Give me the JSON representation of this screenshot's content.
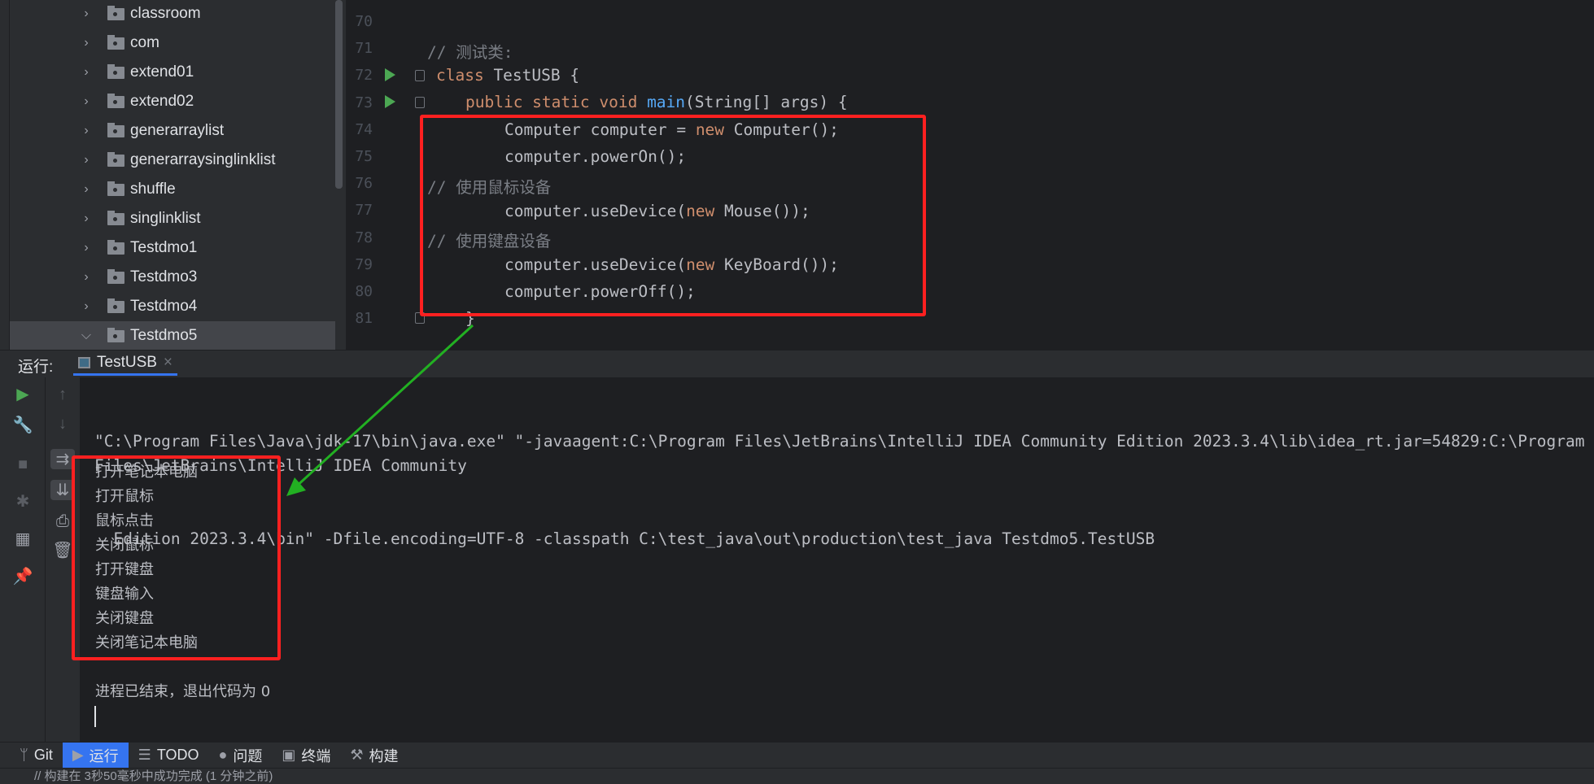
{
  "project_tree": {
    "items": [
      {
        "label": "classroom",
        "expanded": false
      },
      {
        "label": "com",
        "expanded": false
      },
      {
        "label": "extend01",
        "expanded": false
      },
      {
        "label": "extend02",
        "expanded": false
      },
      {
        "label": "generarraylist",
        "expanded": false
      },
      {
        "label": "generarraysinglinklist",
        "expanded": false
      },
      {
        "label": "shuffle",
        "expanded": false
      },
      {
        "label": "singlinklist",
        "expanded": false
      },
      {
        "label": "Testdmo1",
        "expanded": false
      },
      {
        "label": "Testdmo3",
        "expanded": false
      },
      {
        "label": "Testdmo4",
        "expanded": false
      },
      {
        "label": "Testdmo5",
        "expanded": true
      }
    ]
  },
  "editor": {
    "line_numbers": [
      "70",
      "71",
      "72",
      "73",
      "74",
      "75",
      "76",
      "77",
      "78",
      "79",
      "80",
      "81"
    ],
    "comment_test_class": "// 测试类:",
    "kw_class": "class",
    "class_decl": " TestUSB {",
    "kw_main": "public static void ",
    "fn_main": "main",
    "main_rest": "(String[] args) {",
    "l74a": "Computer computer = ",
    "kw_new": "new",
    "l74b": " Computer();",
    "l75": "computer.powerOn();",
    "comment_mouse": "// 使用鼠标设备",
    "l77a": "computer.useDevice(",
    "l77b": " Mouse());",
    "comment_keyboard": "// 使用键盘设备",
    "l79a": "computer.useDevice(",
    "l79b": " KeyBoard());",
    "l80": "computer.powerOff();",
    "l81": "}"
  },
  "run_panel": {
    "label": "运行:",
    "tab": "TestUSB",
    "close": "×",
    "command_line_1": "\"C:\\Program Files\\Java\\jdk-17\\bin\\java.exe\" \"-javaagent:C:\\Program Files\\JetBrains\\IntelliJ IDEA Community Edition 2023.3.4\\lib\\idea_rt.jar=54829:C:\\Program Files\\JetBrains\\IntelliJ IDEA Community",
    "command_line_2": "  Edition 2023.3.4\\bin\" -Dfile.encoding=UTF-8 -classpath C:\\test_java\\out\\production\\test_java Testdmo5.TestUSB",
    "output": [
      "打开笔记本电脑",
      "打开鼠标",
      "鼠标点击",
      "关闭鼠标",
      "打开键盘",
      "键盘输入",
      "关闭键盘",
      "关闭笔记本电脑"
    ],
    "exit_message": "进程已结束，退出代码为 0"
  },
  "bottom_toolbar": [
    {
      "icon": "git-icon",
      "glyph": "ᛘ",
      "label": "Git"
    },
    {
      "icon": "run-icon",
      "glyph": "▶",
      "label": "运行",
      "active": true
    },
    {
      "icon": "todo-icon",
      "glyph": "☰",
      "label": "TODO"
    },
    {
      "icon": "problems-icon",
      "glyph": "●",
      "label": "问题"
    },
    {
      "icon": "terminal-icon",
      "glyph": "▣",
      "label": "终端"
    },
    {
      "icon": "build-icon",
      "glyph": "⚒",
      "label": "构建"
    }
  ],
  "status_bar": {
    "text": "// 构建在 3秒50毫秒中成功完成 (1 分钟之前)"
  },
  "annotation_colors": {
    "box": "#ff2020",
    "arrow": "#22b022"
  }
}
